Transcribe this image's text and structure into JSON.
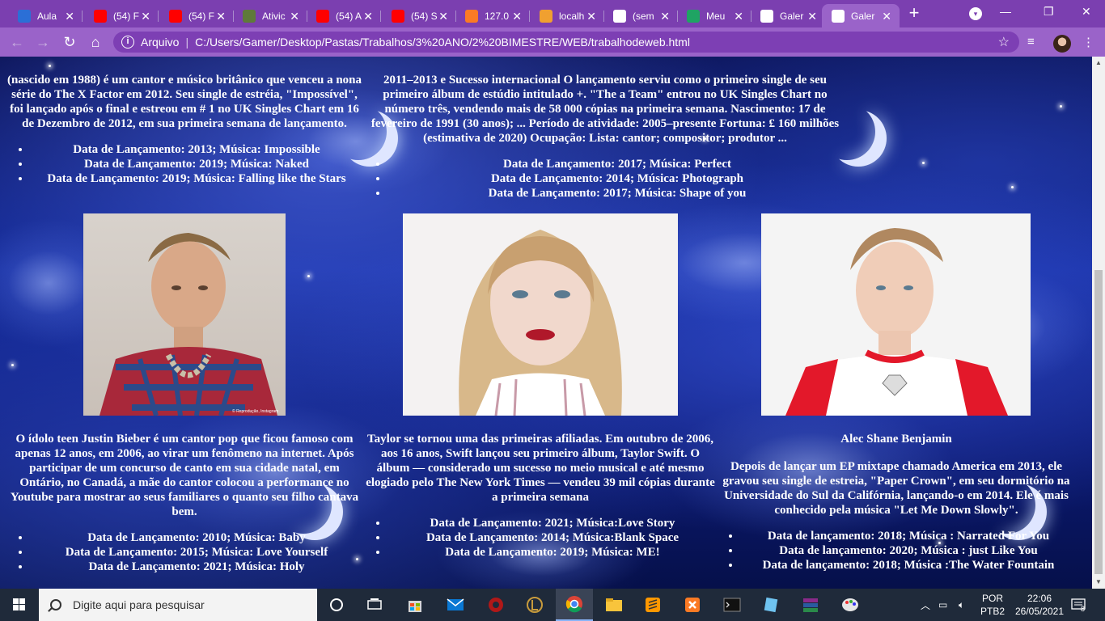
{
  "browser": {
    "tabs": [
      {
        "title": "Aula",
        "favicon": "user-icon",
        "color": "#2b6fd6"
      },
      {
        "title": "(54) F",
        "favicon": "youtube-icon",
        "color": "#ff0000"
      },
      {
        "title": "(54) F",
        "favicon": "youtube-icon",
        "color": "#ff0000"
      },
      {
        "title": "Ativic",
        "favicon": "classroom-icon",
        "color": "#5f7a3a"
      },
      {
        "title": "(54) A",
        "favicon": "youtube-icon",
        "color": "#ff0000"
      },
      {
        "title": "(54) S",
        "favicon": "youtube-icon",
        "color": "#ff0000"
      },
      {
        "title": "127.0",
        "favicon": "xampp-icon",
        "color": "#fb7a24"
      },
      {
        "title": "localh",
        "favicon": "phpmyadmin-icon",
        "color": "#f0a030"
      },
      {
        "title": "(sem",
        "favicon": "gmail-icon",
        "color": "#ffffff"
      },
      {
        "title": "Meu",
        "favicon": "drive-icon",
        "color": "#1fa463"
      },
      {
        "title": "Galer",
        "favicon": "globe-icon",
        "color": "#ffffff"
      },
      {
        "title": "Galer",
        "favicon": "globe-icon",
        "color": "#ffffff",
        "active": true
      }
    ],
    "address": {
      "protocol_label": "Arquivo",
      "url": "C:/Users/Gamer/Desktop/Pastas/Trabalhos/3%20ANO/2%20BIMESTRE/WEB/trabalhodeweb.html"
    }
  },
  "page": {
    "top_left": {
      "text": "(nascido em 1988) é um cantor e músico britânico que venceu a nona série do The X Factor em 2012. Seu single de estréia, \"Impossível\", foi lançado após o final e estreou em # 1 no UK Singles Chart em 16 de Dezembro de 2012, em sua primeira semana de lançamento.",
      "items": [
        "Data de Lançamento: 2013; Música: Impossible",
        "Data de Lançamento: 2019; Música: Naked",
        "Data de Lançamento: 2019; Música: Falling like the Stars"
      ]
    },
    "top_middle": {
      "text": "2011–2013 e Sucesso internacional O lançamento serviu como o primeiro single de seu primeiro álbum de estúdio intitulado +. \"The a Team\" entrou no UK Singles Chart no número três, vendendo mais de 58 000 cópias na primeira semana. Nascimento: 17 de fevereiro de 1991 (30 anos); ... Período de atividade: 2005–presente Fortuna: £ 160 milhões (estimativa de 2020) Ocupação: Lista: cantor; compositor; produtor ...",
      "items": [
        "Data de Lançamento: 2017; Música: Perfect",
        "Data de Lançamento: 2014; Música: Photograph",
        "Data de Lançamento: 2017; Música: Shape of you"
      ]
    },
    "bottom_left": {
      "text": "O ídolo teen Justin Bieber é um cantor pop que ficou famoso com apenas 12 anos, em 2006, ao virar um fenômeno na internet. Após participar de um concurso de canto em sua cidade natal, em Ontário, no Canadá, a mãe do cantor colocou a performance no Youtube para mostrar ao seus familiares o quanto seu filho cantava bem.",
      "items": [
        "Data de Lançamento: 2010; Música: Baby",
        "Data de Lançamento: 2015; Música: Love Yourself",
        "Data de Lançamento: 2021; Música: Holy"
      ]
    },
    "bottom_middle": {
      "text": "Taylor se tornou uma das primeiras afiliadas. Em outubro de 2006, aos 16 anos, Swift lançou seu primeiro álbum, Taylor Swift. O álbum — considerado um sucesso no meio musical e até mesmo elogiado pelo The New York Times — vendeu 39 mil cópias durante a primeira semana",
      "items": [
        "Data de Lançamento: 2021; Música:Love Story",
        "Data de Lançamento: 2014; Música:Blank Space",
        "Data de Lançamento: 2019; Música: ME!"
      ]
    },
    "bottom_right": {
      "heading": "Alec Shane Benjamin",
      "text": "Depois de lançar um EP mixtape chamado America em 2013, ele gravou seu single de estreia, \"Paper Crown\", em seu dormitório na Universidade do Sul da Califórnia, lançando-o em 2014. Ele é mais conhecido pela música \"Let Me Down Slowly\".",
      "items": [
        "Data de lançamento: 2018; Música : Narrated For You",
        "Data de lançamento: 2020; Música : just Like You",
        "Data de lançamento: 2018; Música :The Water Fountain"
      ]
    },
    "photo_caption": "© Reprodução, Instagram"
  },
  "taskbar": {
    "search_placeholder": "Digite aqui para pesquisar",
    "lang_top": "POR",
    "lang_bottom": "PTB2",
    "time": "22:06",
    "date": "26/05/2021",
    "notifications": "8"
  }
}
